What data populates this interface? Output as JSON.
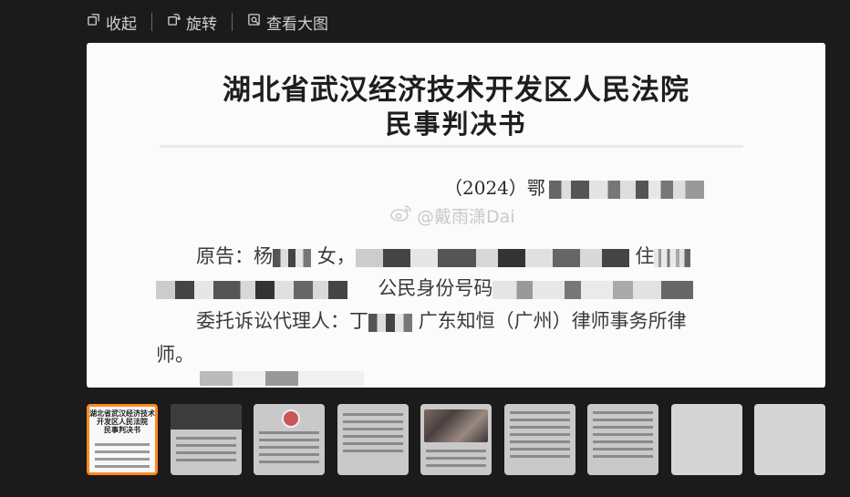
{
  "toolbar": {
    "collapse_label": "收起",
    "rotate_label": "旋转",
    "view_large_label": "查看大图"
  },
  "document": {
    "title": "湖北省武汉经济技术开发区人民法院",
    "subtitle": "民事判决书",
    "case_number_prefix": "（2024）鄂",
    "plaintiff_label": "原告：杨",
    "gender_text": "女，",
    "residence_label": "住",
    "id_label": "公民身份号码",
    "agent_label": "委托诉讼代理人：丁",
    "agent_firm": "广东知恒（广州）律师事务所律",
    "agent_firm_cont": "师。"
  },
  "watermark": {
    "text": "@戴雨潇Dai"
  },
  "thumbnails": {
    "count": 9,
    "active_index": 0,
    "first_title": "湖北省武汉经济技术开发区人民法院",
    "first_subtitle": "民事判决书"
  }
}
